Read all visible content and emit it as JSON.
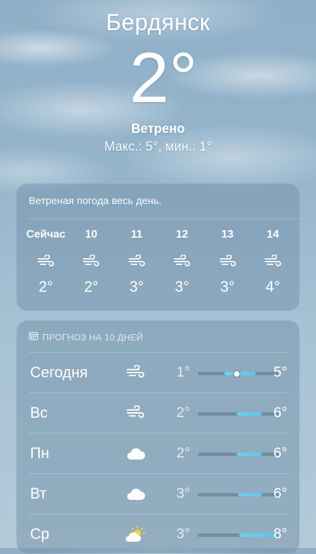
{
  "header": {
    "city": "Бердянск",
    "temp": "2°",
    "condition": "Ветрено",
    "hilo": "Макс.: 5°, мин.: 1°"
  },
  "hourly": {
    "summary": "Ветреная погода весь день.",
    "items": [
      {
        "time": "Сейчас",
        "icon": "wind-icon",
        "temp": "2°"
      },
      {
        "time": "10",
        "icon": "wind-icon",
        "temp": "2°"
      },
      {
        "time": "11",
        "icon": "wind-icon",
        "temp": "3°"
      },
      {
        "time": "12",
        "icon": "wind-icon",
        "temp": "3°"
      },
      {
        "time": "13",
        "icon": "wind-icon",
        "temp": "3°"
      },
      {
        "time": "14",
        "icon": "wind-icon",
        "temp": "4°"
      }
    ]
  },
  "forecast": {
    "title": "ПРОГНОЗ НА 10 ДНЕЙ",
    "title_icon": "calendar-icon",
    "range_colors": {
      "bar": "#6fd0ef",
      "track": "#5a7387"
    },
    "days": [
      {
        "day": "Сегодня",
        "icon": "wind-icon",
        "low": "1°",
        "high": "5°",
        "bar_start": 0.33,
        "bar_end": 0.72,
        "current": 0.48
      },
      {
        "day": "Вс",
        "icon": "wind-icon",
        "low": "2°",
        "high": "6°",
        "bar_start": 0.48,
        "bar_end": 0.8
      },
      {
        "day": "Пн",
        "icon": "cloud-icon",
        "low": "2°",
        "high": "6°",
        "bar_start": 0.48,
        "bar_end": 0.8
      },
      {
        "day": "Вт",
        "icon": "cloud-icon",
        "low": "3°",
        "high": "6°",
        "bar_start": 0.5,
        "bar_end": 0.8
      },
      {
        "day": "Ср",
        "icon": "partly-sunny-icon",
        "low": "3°",
        "high": "8°",
        "bar_start": 0.52,
        "bar_end": 0.98
      }
    ]
  }
}
